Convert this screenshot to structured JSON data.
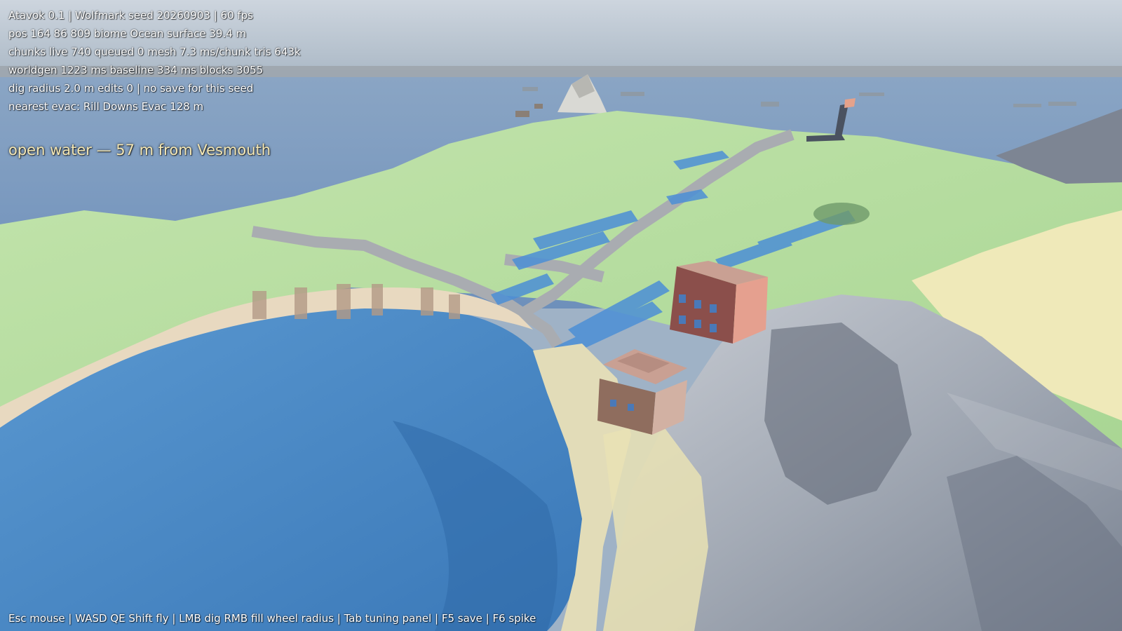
{
  "hud": {
    "title_line": "Atavok 0.1  |  Wolfmark  seed 20260903  |  60 fps",
    "position_line": "pos 164 86 809   biome Ocean   surface 39.4 m",
    "chunks_line": "chunks live 740  queued 0  mesh 7.3 ms/chunk  tris 643k",
    "worldgen_line": "worldgen 1223 ms  baseline 334 ms  blocks 3055",
    "dig_line": "dig radius 2.0 m  edits 0  |  no save for this seed",
    "evac_line": "nearest evac: Rill Downs Evac 128 m",
    "location_banner": "open water  —  57 m from Vesmouth",
    "controls_line": "Esc mouse  |  WASD QE Shift fly  |  LMB dig  RMB fill  wheel radius  |  Tab tuning panel  |  F5 save  |  F6 spike"
  },
  "colors": {
    "sky_top": "#c9d2dc",
    "sky_horizon": "#a9b6c4",
    "ocean_far": "#7e9fc4",
    "ocean_near": "#3f7fbf",
    "grass": "#b8e0a0",
    "sand": "#efe9b6",
    "rock": "#b7bdc6",
    "rock_dark": "#5d6472",
    "road": "#a9acb1",
    "solar_blue": "#4c8fd6",
    "building_roof": "#c9a093",
    "building_wall": "#8b4f4b",
    "location_text": "#f4e7b4"
  }
}
